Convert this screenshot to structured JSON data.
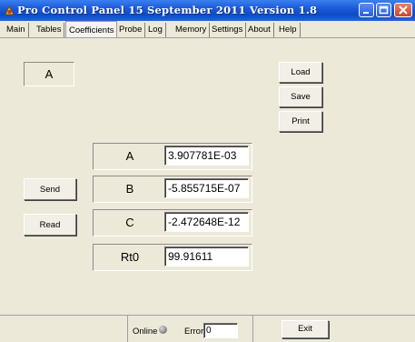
{
  "window": {
    "title": "Pro Control Panel 15 September 2011 Version 1.8",
    "controls": [
      "minimize-icon",
      "maximize-icon",
      "close-icon"
    ]
  },
  "tabs": [
    {
      "label": "Main"
    },
    {
      "label": "Tables"
    },
    {
      "label": "Coefficients"
    },
    {
      "label": "Probe"
    },
    {
      "label": "Log"
    },
    {
      "label": "Memory"
    },
    {
      "label": "Settings"
    },
    {
      "label": "About"
    },
    {
      "label": "Help"
    }
  ],
  "active_tab": "Coefficients",
  "selector": {
    "value": "A"
  },
  "buttons": {
    "load": "Load",
    "save": "Save",
    "print": "Print",
    "send": "Send",
    "read": "Read",
    "exit": "Exit"
  },
  "coefficients": [
    {
      "label": "A",
      "value": "3.907781E-03"
    },
    {
      "label": "B",
      "value": "-5.855715E-07"
    },
    {
      "label": "C",
      "value": "-2.472648E-12"
    },
    {
      "label": "Rt0",
      "value": "99.91611"
    }
  ],
  "status": {
    "online_label": "Online",
    "online_indicator_color": "#8a8a8a",
    "error_label": "Error",
    "error_value": "0"
  },
  "colors": {
    "titlebar": "#0d4bc8",
    "background": "#ece9d8"
  }
}
